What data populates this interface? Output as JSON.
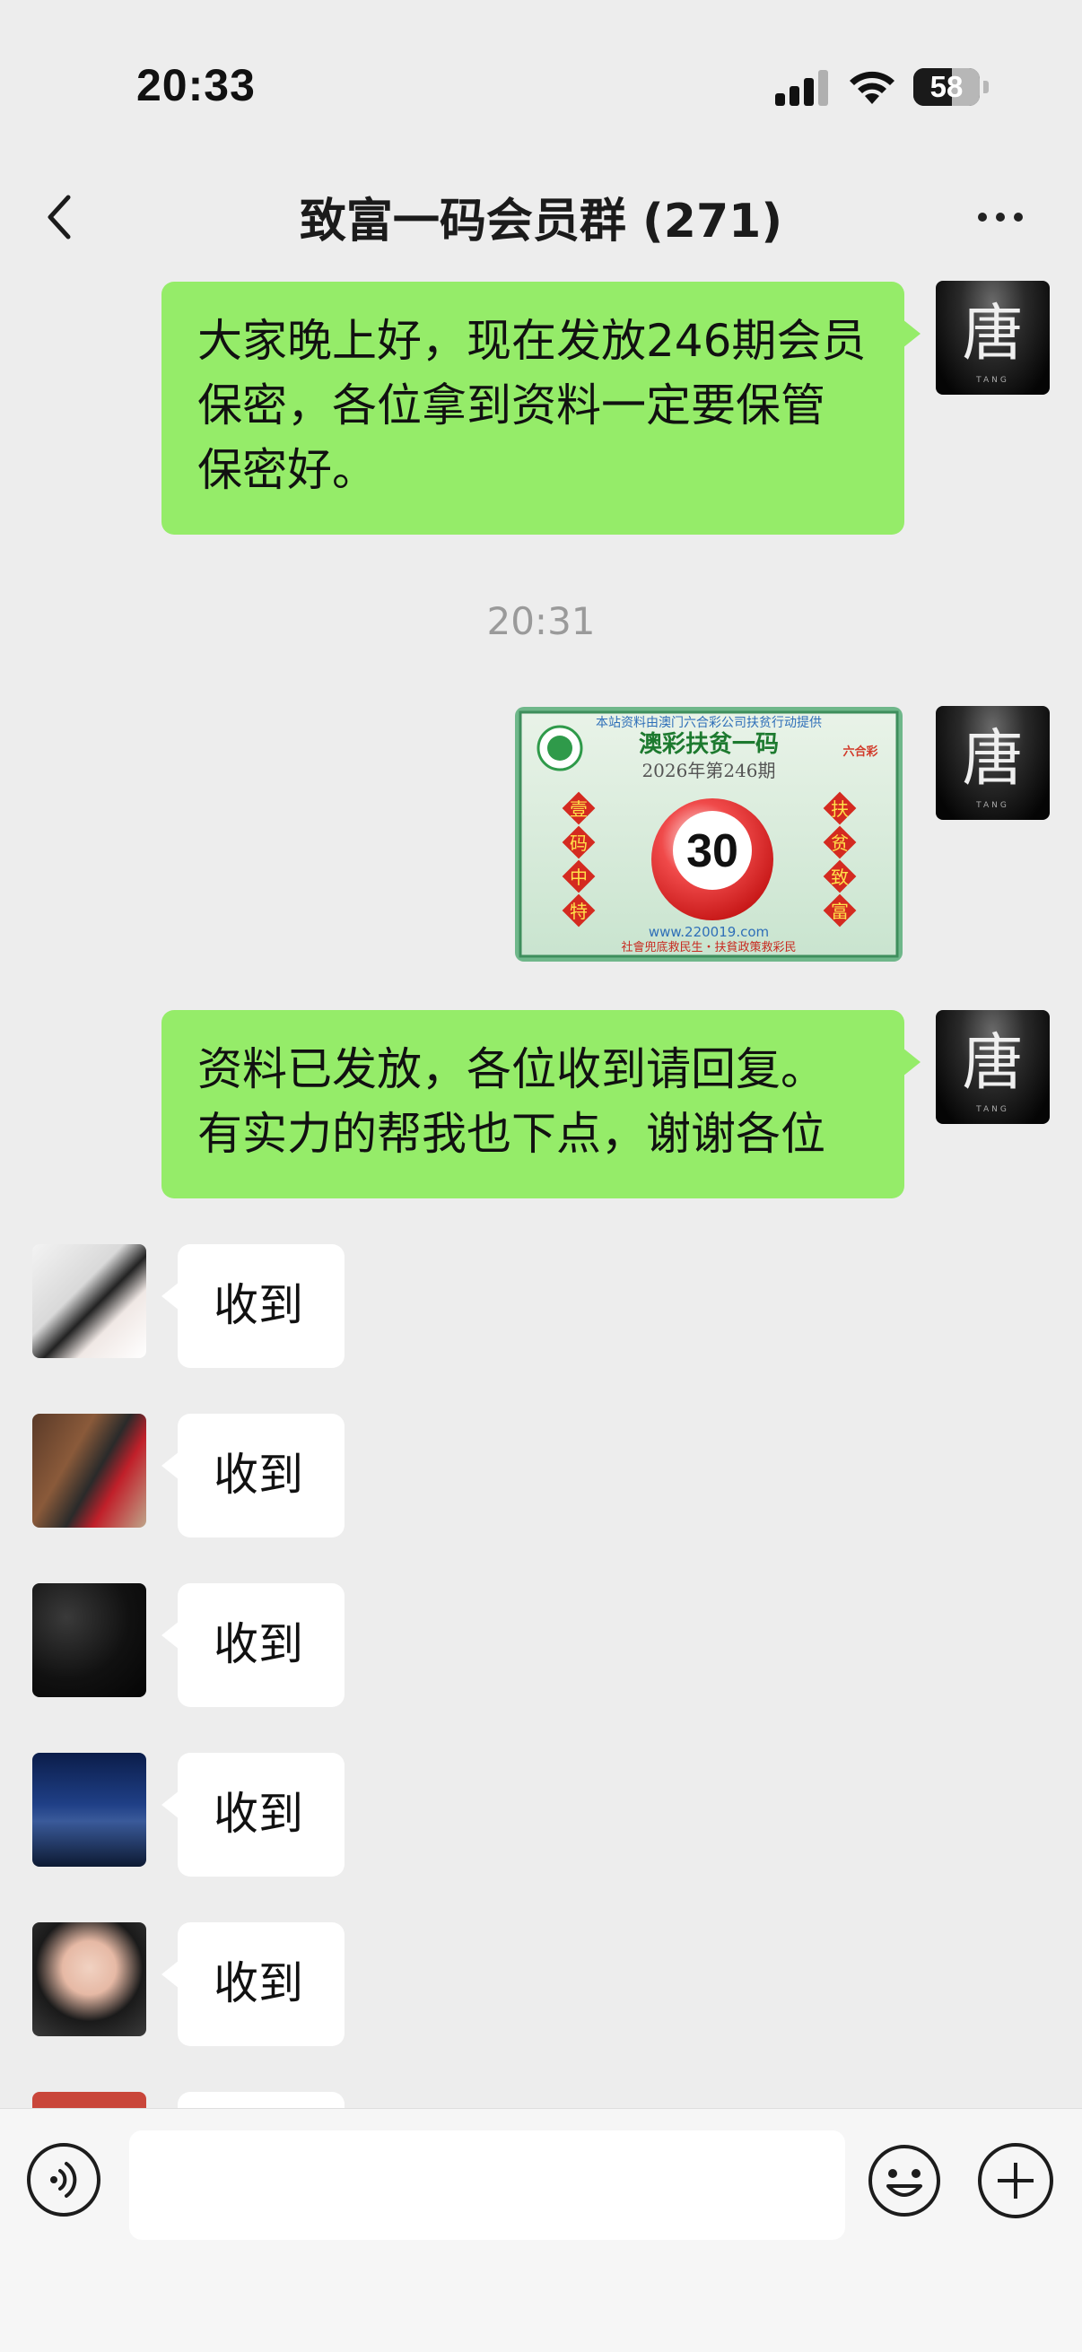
{
  "status_bar": {
    "time": "20:33",
    "battery_level": "58"
  },
  "nav": {
    "title": "致富一码会员群 (271)",
    "back_icon": "chevron-left-icon",
    "more_icon": "ellipsis-icon"
  },
  "messages": {
    "sent_1": "大家晚上好，现在发放246期会员保密，各位拿到资料一定要保管保密好。",
    "timestamp": "20:31",
    "lottery_image": {
      "top_line": "本站资料由澳门六合彩公司扶贫行动提供",
      "title": "澳彩扶贫一码",
      "issue": "2026年第246期",
      "number": "30",
      "left_chars": [
        "壹",
        "码",
        "中",
        "特"
      ],
      "right_chars": [
        "扶",
        "贫",
        "致",
        "富"
      ],
      "website": "www.220019.com",
      "slogan": "社會兜底救民生・扶貧政策救彩民",
      "logo_text": "六合彩"
    },
    "sent_2": "资料已发放，各位收到请回复。有实力的帮我也下点，谢谢各位",
    "sender_avatar_char": "唐",
    "sender_avatar_sub": "TANG",
    "replies": [
      "收到",
      "收到",
      "收到",
      "收到",
      "收到"
    ]
  },
  "colors": {
    "bubble_sent": "#95ec69",
    "bubble_received": "#ffffff",
    "background": "#ededed"
  }
}
